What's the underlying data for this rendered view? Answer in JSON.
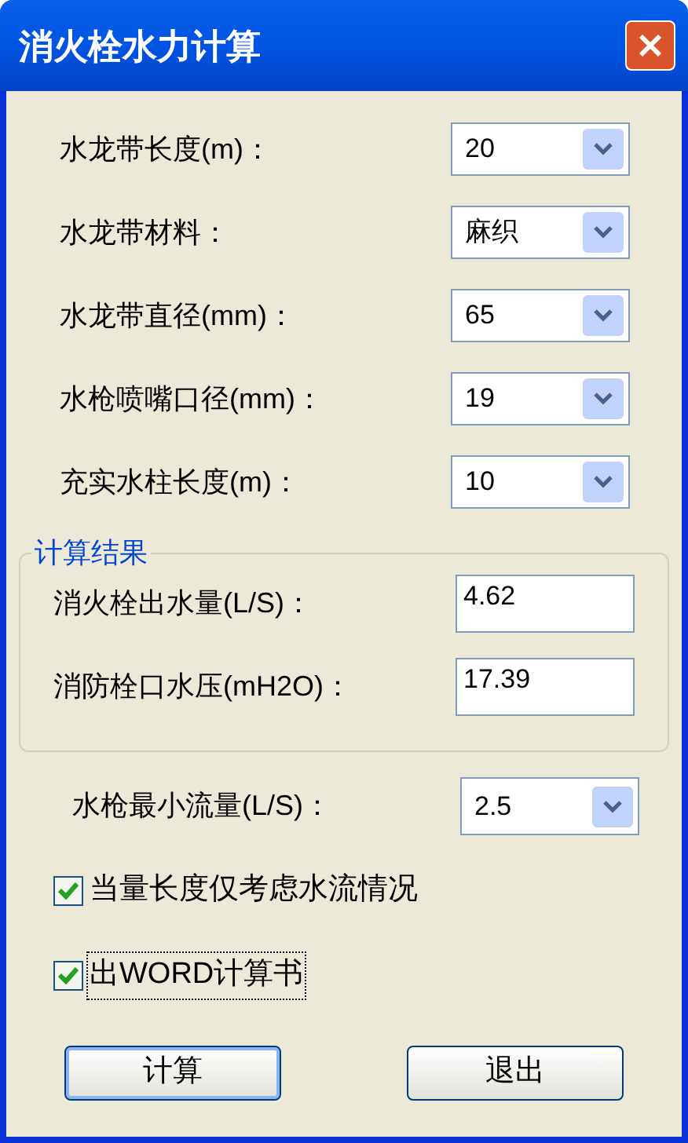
{
  "window": {
    "title": "消火栓水力计算"
  },
  "inputs": [
    {
      "label": "水龙带长度(m)：",
      "value": "20"
    },
    {
      "label": "水龙带材料：",
      "value": "麻织"
    },
    {
      "label": "水龙带直径(mm)：",
      "value": "65"
    },
    {
      "label": "水枪喷嘴口径(mm)：",
      "value": "19"
    },
    {
      "label": "充实水柱长度(m)：",
      "value": "10"
    }
  ],
  "results": {
    "title": "计算结果",
    "fields": [
      {
        "label": "消火栓出水量(L/S)：",
        "value": "4.62"
      },
      {
        "label": "消防栓口水压(mH2O)：",
        "value": "17.39"
      }
    ]
  },
  "min_flow": {
    "label": "水枪最小流量(L/S)：",
    "value": "2.5"
  },
  "checkboxes": [
    {
      "label": "当量长度仅考虑水流情况",
      "checked": true,
      "focused": false
    },
    {
      "label": "出WORD计算书",
      "checked": true,
      "focused": true
    }
  ],
  "buttons": [
    {
      "label": "计算",
      "default": true
    },
    {
      "label": "退出",
      "default": false
    }
  ]
}
